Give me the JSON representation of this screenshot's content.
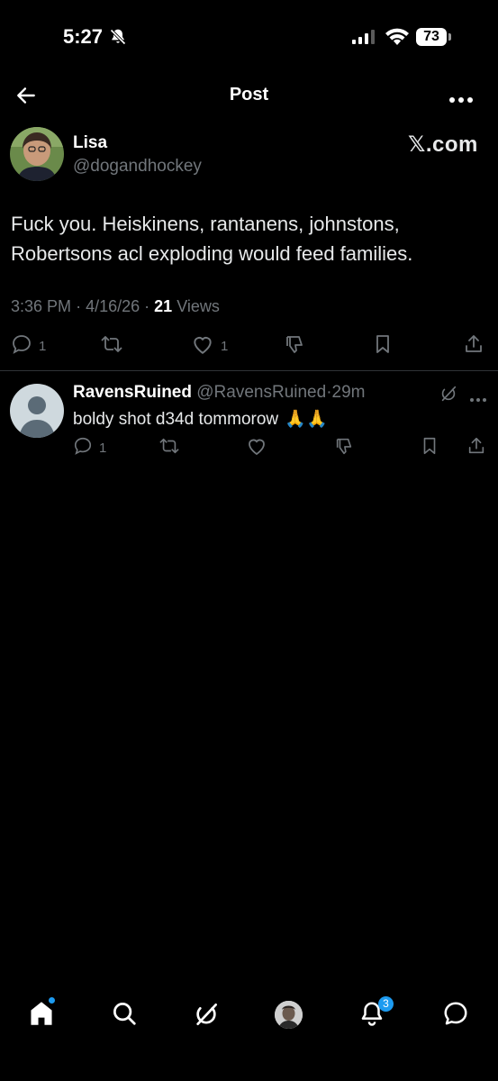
{
  "status_bar": {
    "time": "5:27",
    "battery": "73",
    "icons": [
      "bell-off-icon",
      "signal-icon",
      "wifi-icon",
      "battery-icon"
    ]
  },
  "header": {
    "title": "Post",
    "icons": [
      "back-arrow-icon",
      "more-icon"
    ]
  },
  "post": {
    "author_name": "Lisa",
    "author_handle": "@dogandhockey",
    "watermark": "𝕏.com",
    "text": "Fuck you. Heiskinens, rantanens, johnstons, Robertsons acl exploding would feed families.",
    "time": "3:36 PM",
    "date": "4/16/26",
    "views_count": "21",
    "views_label": "Views",
    "actions": {
      "replies": "1",
      "reposts": "",
      "likes": "1"
    }
  },
  "reply": {
    "name": "RavensRuined",
    "handle": "@RavensRuined",
    "separator": "·",
    "time": "29m",
    "text": "boldy shot d34d tommorow",
    "emoji": "🙏🙏",
    "actions": {
      "replies": "1"
    }
  },
  "tab_bar": {
    "notifications_badge": "3",
    "icons": [
      "home-icon",
      "search-icon",
      "grok-icon",
      "profile-avatar",
      "bell-icon",
      "chat-icon"
    ]
  },
  "colors": {
    "background": "#000000",
    "text": "#e7e9ea",
    "muted": "#71767b",
    "accent": "#1d9bf0",
    "divider": "#2f3336"
  }
}
